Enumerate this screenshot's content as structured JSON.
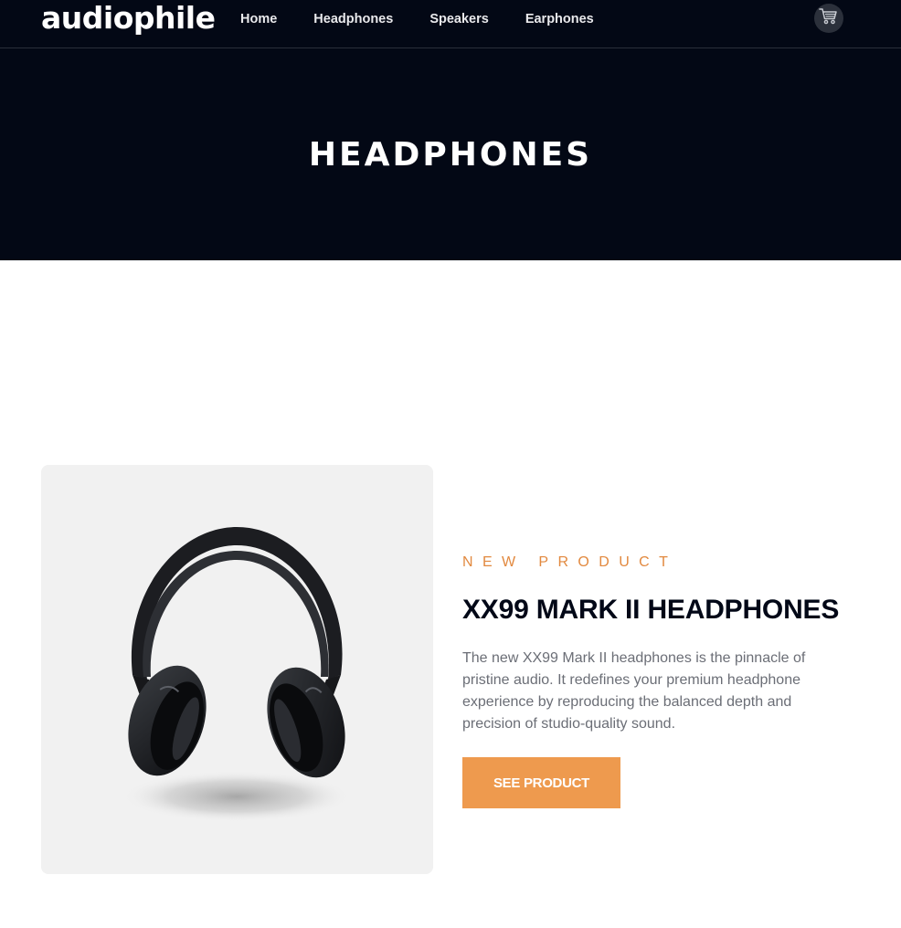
{
  "header": {
    "logo": "audiophile",
    "nav": [
      {
        "label": "Home"
      },
      {
        "label": "Headphones"
      },
      {
        "label": "Speakers"
      },
      {
        "label": "Earphones"
      }
    ],
    "cart_icon": "cart-icon"
  },
  "hero": {
    "title": "HEADPHONES"
  },
  "product": {
    "overline": "NEW PRODUCT",
    "title": "XX99 MARK II HEADPHONES",
    "description": "The new XX99 Mark II headphones is the pinnacle of pristine audio. It redefines your premium headphone experience by reproducing the balanced depth and precision of studio-quality sound.",
    "button_label": "SEE PRODUCT",
    "image_icon": "headphones-image"
  },
  "colors": {
    "dark": "#030815",
    "accent": "#ee9a4e",
    "overline": "#e2893f",
    "card_bg": "#f1f1f1"
  }
}
